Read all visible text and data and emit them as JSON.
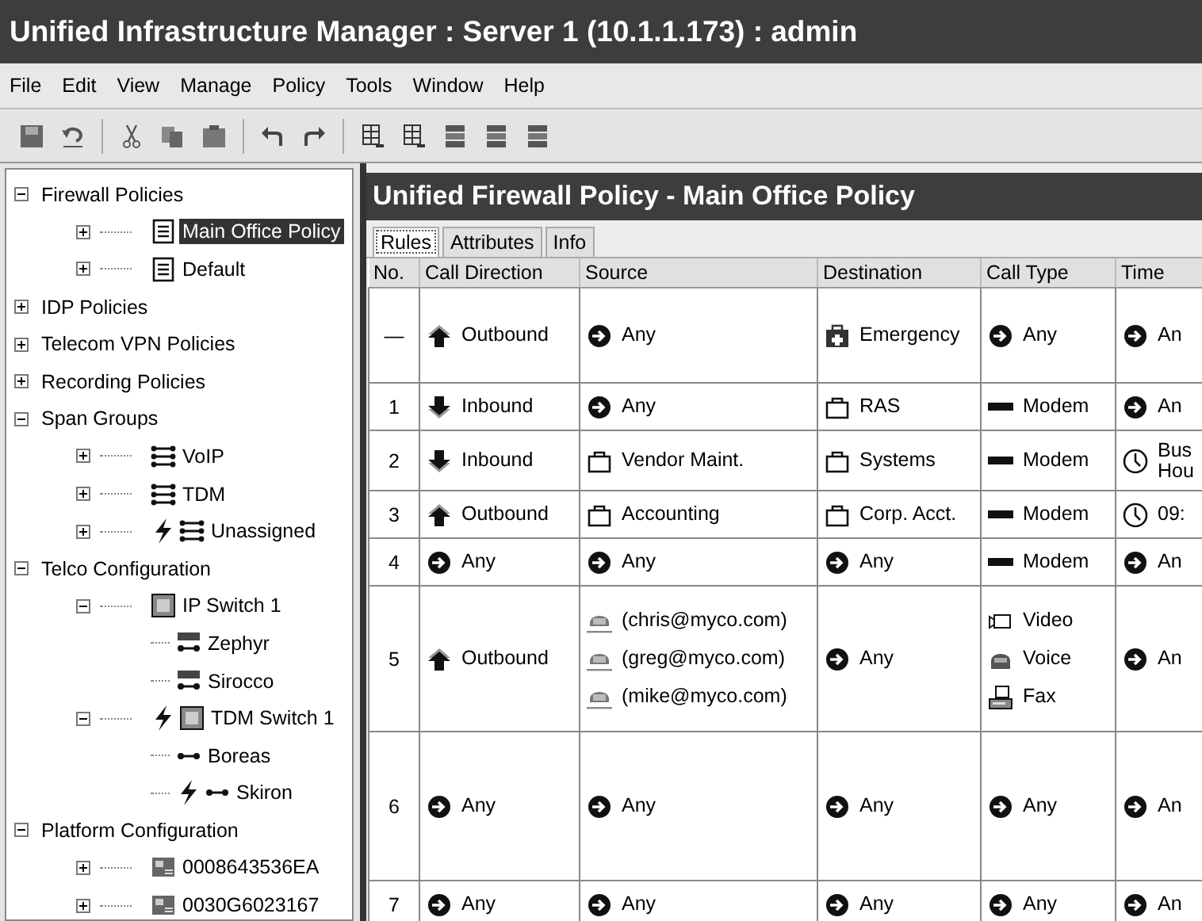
{
  "window": {
    "title": "Unified Infrastructure Manager : Server 1 (10.1.1.173) : admin"
  },
  "menu": [
    "File",
    "Edit",
    "View",
    "Manage",
    "Policy",
    "Tools",
    "Window",
    "Help"
  ],
  "tree": [
    {
      "label": "Firewall Policies",
      "expanded": true,
      "children": [
        {
          "label": "Main Office Policy",
          "kind": "policy",
          "expanded": false,
          "selected": true
        },
        {
          "label": "Default",
          "kind": "policy",
          "expanded": false,
          "selected": false
        }
      ]
    },
    {
      "label": "IDP Policies",
      "expanded": false
    },
    {
      "label": "Telecom VPN Policies",
      "expanded": false
    },
    {
      "label": "Recording Policies",
      "expanded": false
    },
    {
      "label": "Span Groups",
      "expanded": true,
      "children": [
        {
          "label": "VoIP",
          "kind": "span",
          "expanded": false
        },
        {
          "label": "TDM",
          "kind": "span",
          "expanded": false
        },
        {
          "label": "Unassigned",
          "kind": "span",
          "expanded": false,
          "alert": true
        }
      ]
    },
    {
      "label": "Telco Configuration",
      "expanded": true,
      "children": [
        {
          "label": "IP Switch 1",
          "kind": "switch",
          "expanded": true,
          "children": [
            {
              "label": "Zephyr",
              "kind": "voip"
            },
            {
              "label": "Sirocco",
              "kind": "voip"
            }
          ]
        },
        {
          "label": "TDM Switch 1",
          "kind": "switch",
          "expanded": true,
          "alert": true,
          "children": [
            {
              "label": "Boreas",
              "kind": "link"
            },
            {
              "label": "Skiron",
              "kind": "link",
              "alert": true
            }
          ]
        }
      ]
    },
    {
      "label": "Platform Configuration",
      "expanded": true,
      "children": [
        {
          "label": "0008643536EA",
          "kind": "device",
          "expanded": false
        },
        {
          "label": "0030G6023167",
          "kind": "device",
          "expanded": false
        }
      ]
    }
  ],
  "panel": {
    "title": "Unified Firewall Policy - Main Office Policy",
    "tabs": [
      {
        "label": "Rules",
        "selected": true
      },
      {
        "label": "Attributes",
        "selected": false
      },
      {
        "label": "Info",
        "selected": false
      }
    ],
    "columns": [
      "No.",
      "Call Direction",
      "Source",
      "Destination",
      "Call Type",
      "Time"
    ],
    "rows": [
      {
        "cells": [
          [
            {
              "kind": "number",
              "text": "—"
            }
          ],
          [
            {
              "kind": "outbound",
              "text": "Outbound"
            }
          ],
          [
            {
              "kind": "any",
              "text": "Any"
            }
          ],
          [
            {
              "kind": "emergency",
              "text": "Emergency"
            }
          ],
          [
            {
              "kind": "any",
              "text": "Any"
            }
          ],
          [
            {
              "kind": "any",
              "text": "An"
            }
          ]
        ]
      },
      {
        "cells": [
          [
            {
              "kind": "number",
              "text": "1"
            }
          ],
          [
            {
              "kind": "inbound",
              "text": "Inbound"
            }
          ],
          [
            {
              "kind": "any",
              "text": "Any"
            }
          ],
          [
            {
              "kind": "group",
              "text": "RAS"
            }
          ],
          [
            {
              "kind": "modem",
              "text": "Modem"
            }
          ],
          [
            {
              "kind": "any",
              "text": "An"
            }
          ]
        ]
      },
      {
        "cells": [
          [
            {
              "kind": "number",
              "text": "2"
            }
          ],
          [
            {
              "kind": "inbound",
              "text": "Inbound"
            }
          ],
          [
            {
              "kind": "group",
              "text": "Vendor Maint."
            }
          ],
          [
            {
              "kind": "group",
              "text": "Systems"
            }
          ],
          [
            {
              "kind": "modem",
              "text": "Modem"
            }
          ],
          [
            {
              "kind": "clock",
              "text": "Bus\nHou"
            }
          ]
        ]
      },
      {
        "cells": [
          [
            {
              "kind": "number",
              "text": "3"
            }
          ],
          [
            {
              "kind": "outbound",
              "text": "Outbound"
            }
          ],
          [
            {
              "kind": "group",
              "text": "Accounting"
            }
          ],
          [
            {
              "kind": "group",
              "text": "Corp. Acct."
            }
          ],
          [
            {
              "kind": "modem",
              "text": "Modem"
            }
          ],
          [
            {
              "kind": "clock",
              "text": "09:"
            }
          ]
        ]
      },
      {
        "cells": [
          [
            {
              "kind": "number",
              "text": "4"
            }
          ],
          [
            {
              "kind": "any",
              "text": "Any"
            }
          ],
          [
            {
              "kind": "any",
              "text": "Any"
            }
          ],
          [
            {
              "kind": "any",
              "text": "Any"
            }
          ],
          [
            {
              "kind": "modem",
              "text": "Modem"
            }
          ],
          [
            {
              "kind": "any",
              "text": "An"
            }
          ]
        ]
      },
      {
        "cells": [
          [
            {
              "kind": "number",
              "text": "5"
            }
          ],
          [
            {
              "kind": "outbound",
              "text": "Outbound"
            }
          ],
          [
            {
              "kind": "user",
              "text": "(chris@myco.com)"
            },
            {
              "kind": "user",
              "text": "(greg@myco.com)"
            },
            {
              "kind": "user",
              "text": "(mike@myco.com)"
            }
          ],
          [
            {
              "kind": "any",
              "text": "Any"
            }
          ],
          [
            {
              "kind": "video",
              "text": "Video"
            },
            {
              "kind": "voice",
              "text": "Voice"
            },
            {
              "kind": "fax",
              "text": "Fax"
            }
          ],
          [
            {
              "kind": "any",
              "text": "An"
            }
          ]
        ]
      },
      {
        "cells": [
          [
            {
              "kind": "number",
              "text": "6"
            }
          ],
          [
            {
              "kind": "any",
              "text": "Any"
            }
          ],
          [
            {
              "kind": "any",
              "text": "Any"
            }
          ],
          [
            {
              "kind": "any",
              "text": "Any"
            }
          ],
          [
            {
              "kind": "any",
              "text": "Any"
            }
          ],
          [
            {
              "kind": "any",
              "text": "An"
            }
          ]
        ]
      },
      {
        "cells": [
          [
            {
              "kind": "number",
              "text": "7"
            }
          ],
          [
            {
              "kind": "any",
              "text": "Any"
            }
          ],
          [
            {
              "kind": "any",
              "text": "Any"
            }
          ],
          [
            {
              "kind": "any",
              "text": "Any"
            }
          ],
          [
            {
              "kind": "any",
              "text": "Any"
            }
          ],
          [
            {
              "kind": "any",
              "text": "An"
            }
          ]
        ]
      }
    ]
  }
}
